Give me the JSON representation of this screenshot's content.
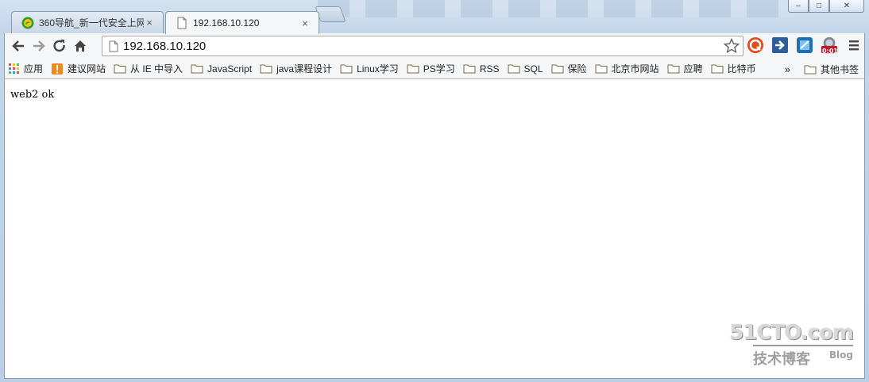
{
  "window": {
    "controls": {
      "minimize": "–",
      "maximize": "□",
      "close": "✕"
    }
  },
  "tabs": [
    {
      "label": "360导航_新一代安全上网",
      "close": "×",
      "active": false,
      "favicon": "360-logo-icon"
    },
    {
      "label": "192.168.10.120",
      "close": "×",
      "active": true,
      "favicon": "page-icon"
    }
  ],
  "toolbar": {
    "back": "back-arrow-icon",
    "forward": "forward-arrow-icon",
    "reload": "reload-icon",
    "home": "home-icon",
    "address": "192.168.10.120",
    "extensions": [
      "q-extension-icon",
      "arrow-extension-icon",
      "app-extension-icon",
      "timer-extension-icon",
      "menu-icon"
    ],
    "timer_badge": "0:01"
  },
  "bookmarks": {
    "items": [
      {
        "label": "应用",
        "icon": "apps-grid-icon"
      },
      {
        "label": "建议网站",
        "icon": "suggest-icon"
      },
      {
        "label": "从 IE 中导入",
        "icon": "folder-icon"
      },
      {
        "label": "JavaScript",
        "icon": "folder-icon"
      },
      {
        "label": "java课程设计",
        "icon": "folder-icon"
      },
      {
        "label": "Linux学习",
        "icon": "folder-icon"
      },
      {
        "label": "PS学习",
        "icon": "folder-icon"
      },
      {
        "label": "RSS",
        "icon": "folder-icon"
      },
      {
        "label": "SQL",
        "icon": "folder-icon"
      },
      {
        "label": "保险",
        "icon": "folder-icon"
      },
      {
        "label": "北京市网站",
        "icon": "folder-icon"
      },
      {
        "label": "应聘",
        "icon": "folder-icon"
      },
      {
        "label": "比特币",
        "icon": "folder-icon"
      }
    ],
    "more": "»",
    "other": "其他书签"
  },
  "content": {
    "text": "web2 ok"
  },
  "watermark": {
    "site": "51CTO.com",
    "subtitle": "技术博客",
    "blog": "Blog"
  }
}
